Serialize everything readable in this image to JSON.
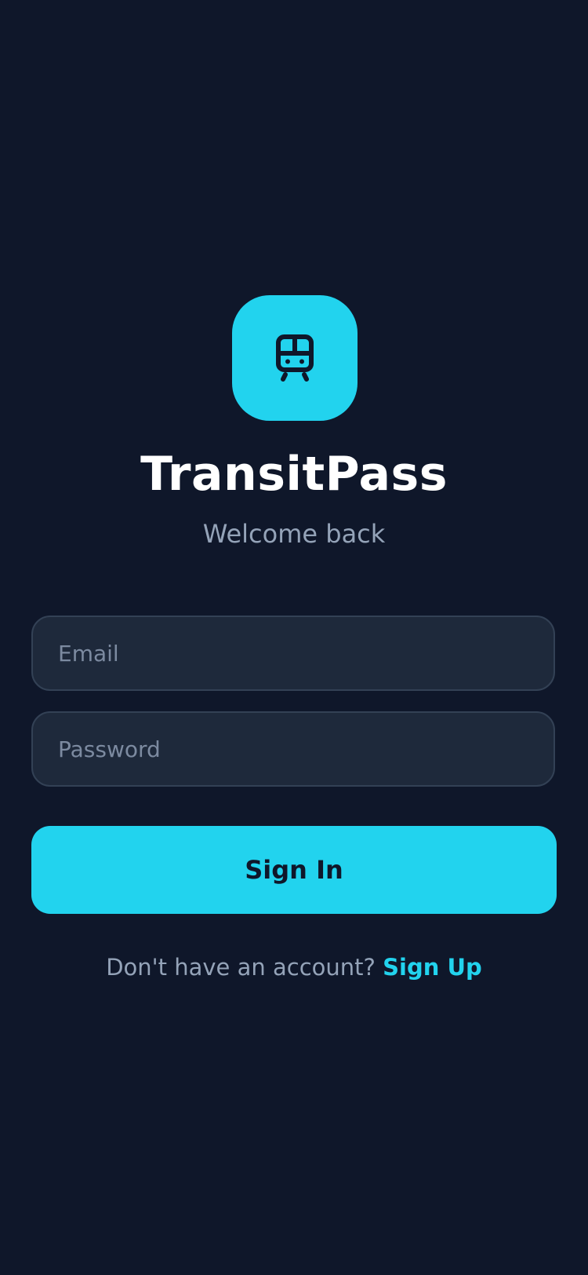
{
  "app": {
    "name": "TransitPass",
    "subtitle": "Welcome back",
    "icon": "train-icon",
    "accent_color": "#22d3ee",
    "background_color": "#0f172a"
  },
  "form": {
    "email": {
      "placeholder": "Email",
      "value": ""
    },
    "password": {
      "placeholder": "Password",
      "value": ""
    },
    "submit_label": "Sign In"
  },
  "footer": {
    "prompt": "Don't have an account? ",
    "link_label": "Sign Up"
  }
}
